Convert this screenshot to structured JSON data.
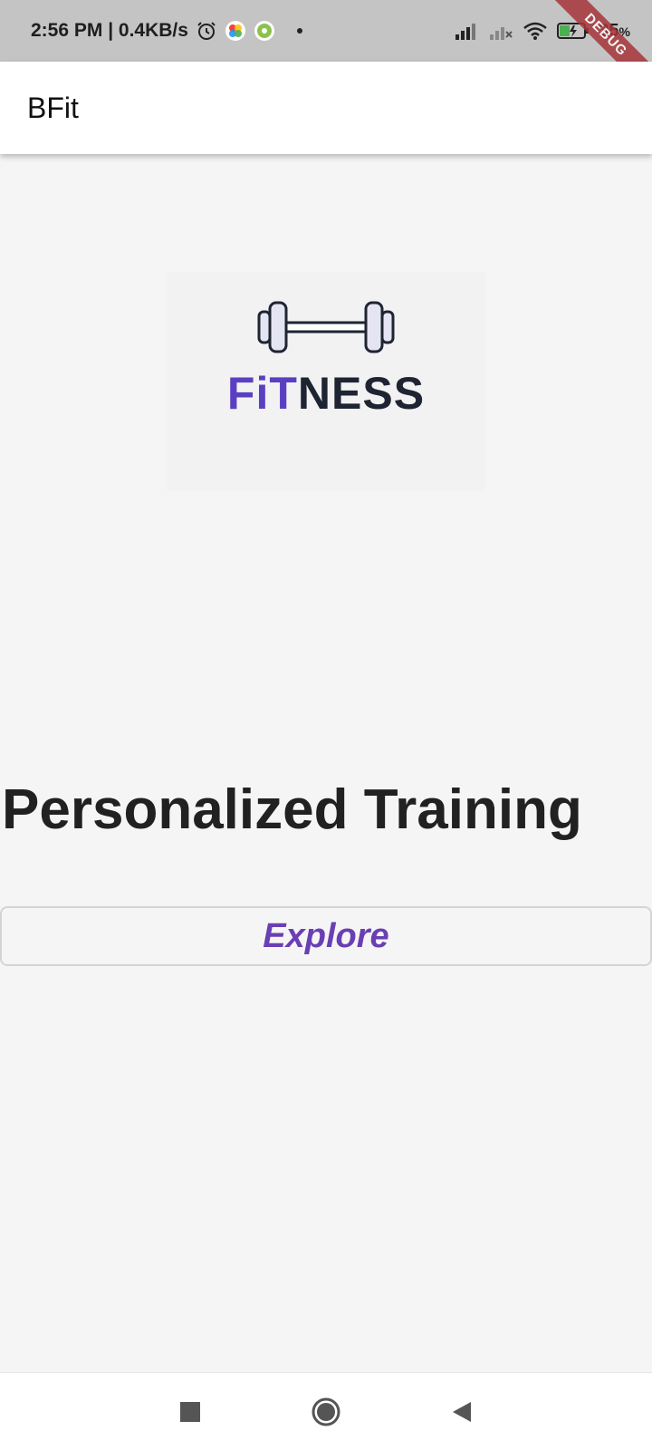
{
  "status_bar": {
    "time_speed": "2:56 PM | 0.4KB/s",
    "battery": "35",
    "battery_unit": "%",
    "icons": [
      "alarm-icon",
      "photos-app-icon",
      "settings-app-icon",
      "signal-icon",
      "signal-no-service-icon",
      "wifi-icon",
      "battery-charging-icon"
    ]
  },
  "debug_banner": {
    "label": "DEBUG"
  },
  "app_bar": {
    "title": "BFit"
  },
  "logo": {
    "word_accent": "FiT",
    "word_rest": "NESS",
    "icon": "dumbbell-icon"
  },
  "main": {
    "headline": "Personalized Training",
    "explore_label": "Explore"
  },
  "nav_bar": {
    "items": [
      "recents-square-icon",
      "home-circle-icon",
      "back-triangle-icon"
    ]
  },
  "colors": {
    "background": "#f5f5f5",
    "accent": "#6a3fb3",
    "logo_accent": "#5b3fc2",
    "logo_dark": "#1f2433",
    "status_bar": "#c4c4c4",
    "debug_banner": "#a7353a"
  }
}
